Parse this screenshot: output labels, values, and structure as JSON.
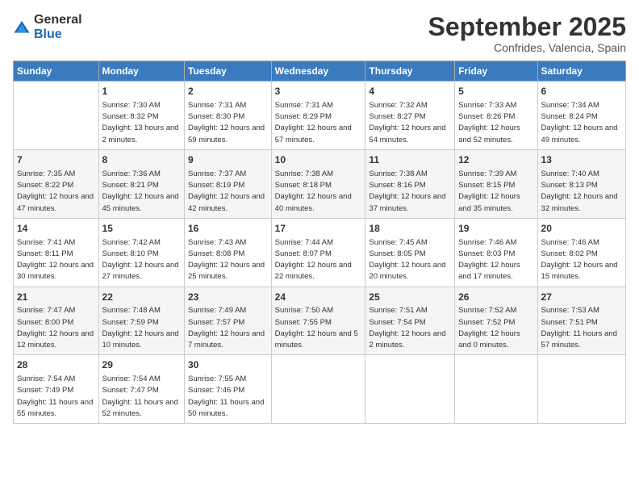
{
  "header": {
    "logo_general": "General",
    "logo_blue": "Blue",
    "title": "September 2025",
    "subtitle": "Confrides, Valencia, Spain"
  },
  "days_of_week": [
    "Sunday",
    "Monday",
    "Tuesday",
    "Wednesday",
    "Thursday",
    "Friday",
    "Saturday"
  ],
  "weeks": [
    [
      {
        "day": "",
        "sunrise": "",
        "sunset": "",
        "daylight": ""
      },
      {
        "day": "1",
        "sunrise": "Sunrise: 7:30 AM",
        "sunset": "Sunset: 8:32 PM",
        "daylight": "Daylight: 13 hours and 2 minutes."
      },
      {
        "day": "2",
        "sunrise": "Sunrise: 7:31 AM",
        "sunset": "Sunset: 8:30 PM",
        "daylight": "Daylight: 12 hours and 59 minutes."
      },
      {
        "day": "3",
        "sunrise": "Sunrise: 7:31 AM",
        "sunset": "Sunset: 8:29 PM",
        "daylight": "Daylight: 12 hours and 57 minutes."
      },
      {
        "day": "4",
        "sunrise": "Sunrise: 7:32 AM",
        "sunset": "Sunset: 8:27 PM",
        "daylight": "Daylight: 12 hours and 54 minutes."
      },
      {
        "day": "5",
        "sunrise": "Sunrise: 7:33 AM",
        "sunset": "Sunset: 8:26 PM",
        "daylight": "Daylight: 12 hours and 52 minutes."
      },
      {
        "day": "6",
        "sunrise": "Sunrise: 7:34 AM",
        "sunset": "Sunset: 8:24 PM",
        "daylight": "Daylight: 12 hours and 49 minutes."
      }
    ],
    [
      {
        "day": "7",
        "sunrise": "Sunrise: 7:35 AM",
        "sunset": "Sunset: 8:22 PM",
        "daylight": "Daylight: 12 hours and 47 minutes."
      },
      {
        "day": "8",
        "sunrise": "Sunrise: 7:36 AM",
        "sunset": "Sunset: 8:21 PM",
        "daylight": "Daylight: 12 hours and 45 minutes."
      },
      {
        "day": "9",
        "sunrise": "Sunrise: 7:37 AM",
        "sunset": "Sunset: 8:19 PM",
        "daylight": "Daylight: 12 hours and 42 minutes."
      },
      {
        "day": "10",
        "sunrise": "Sunrise: 7:38 AM",
        "sunset": "Sunset: 8:18 PM",
        "daylight": "Daylight: 12 hours and 40 minutes."
      },
      {
        "day": "11",
        "sunrise": "Sunrise: 7:38 AM",
        "sunset": "Sunset: 8:16 PM",
        "daylight": "Daylight: 12 hours and 37 minutes."
      },
      {
        "day": "12",
        "sunrise": "Sunrise: 7:39 AM",
        "sunset": "Sunset: 8:15 PM",
        "daylight": "Daylight: 12 hours and 35 minutes."
      },
      {
        "day": "13",
        "sunrise": "Sunrise: 7:40 AM",
        "sunset": "Sunset: 8:13 PM",
        "daylight": "Daylight: 12 hours and 32 minutes."
      }
    ],
    [
      {
        "day": "14",
        "sunrise": "Sunrise: 7:41 AM",
        "sunset": "Sunset: 8:11 PM",
        "daylight": "Daylight: 12 hours and 30 minutes."
      },
      {
        "day": "15",
        "sunrise": "Sunrise: 7:42 AM",
        "sunset": "Sunset: 8:10 PM",
        "daylight": "Daylight: 12 hours and 27 minutes."
      },
      {
        "day": "16",
        "sunrise": "Sunrise: 7:43 AM",
        "sunset": "Sunset: 8:08 PM",
        "daylight": "Daylight: 12 hours and 25 minutes."
      },
      {
        "day": "17",
        "sunrise": "Sunrise: 7:44 AM",
        "sunset": "Sunset: 8:07 PM",
        "daylight": "Daylight: 12 hours and 22 minutes."
      },
      {
        "day": "18",
        "sunrise": "Sunrise: 7:45 AM",
        "sunset": "Sunset: 8:05 PM",
        "daylight": "Daylight: 12 hours and 20 minutes."
      },
      {
        "day": "19",
        "sunrise": "Sunrise: 7:46 AM",
        "sunset": "Sunset: 8:03 PM",
        "daylight": "Daylight: 12 hours and 17 minutes."
      },
      {
        "day": "20",
        "sunrise": "Sunrise: 7:46 AM",
        "sunset": "Sunset: 8:02 PM",
        "daylight": "Daylight: 12 hours and 15 minutes."
      }
    ],
    [
      {
        "day": "21",
        "sunrise": "Sunrise: 7:47 AM",
        "sunset": "Sunset: 8:00 PM",
        "daylight": "Daylight: 12 hours and 12 minutes."
      },
      {
        "day": "22",
        "sunrise": "Sunrise: 7:48 AM",
        "sunset": "Sunset: 7:59 PM",
        "daylight": "Daylight: 12 hours and 10 minutes."
      },
      {
        "day": "23",
        "sunrise": "Sunrise: 7:49 AM",
        "sunset": "Sunset: 7:57 PM",
        "daylight": "Daylight: 12 hours and 7 minutes."
      },
      {
        "day": "24",
        "sunrise": "Sunrise: 7:50 AM",
        "sunset": "Sunset: 7:55 PM",
        "daylight": "Daylight: 12 hours and 5 minutes."
      },
      {
        "day": "25",
        "sunrise": "Sunrise: 7:51 AM",
        "sunset": "Sunset: 7:54 PM",
        "daylight": "Daylight: 12 hours and 2 minutes."
      },
      {
        "day": "26",
        "sunrise": "Sunrise: 7:52 AM",
        "sunset": "Sunset: 7:52 PM",
        "daylight": "Daylight: 12 hours and 0 minutes."
      },
      {
        "day": "27",
        "sunrise": "Sunrise: 7:53 AM",
        "sunset": "Sunset: 7:51 PM",
        "daylight": "Daylight: 11 hours and 57 minutes."
      }
    ],
    [
      {
        "day": "28",
        "sunrise": "Sunrise: 7:54 AM",
        "sunset": "Sunset: 7:49 PM",
        "daylight": "Daylight: 11 hours and 55 minutes."
      },
      {
        "day": "29",
        "sunrise": "Sunrise: 7:54 AM",
        "sunset": "Sunset: 7:47 PM",
        "daylight": "Daylight: 11 hours and 52 minutes."
      },
      {
        "day": "30",
        "sunrise": "Sunrise: 7:55 AM",
        "sunset": "Sunset: 7:46 PM",
        "daylight": "Daylight: 11 hours and 50 minutes."
      },
      {
        "day": "",
        "sunrise": "",
        "sunset": "",
        "daylight": ""
      },
      {
        "day": "",
        "sunrise": "",
        "sunset": "",
        "daylight": ""
      },
      {
        "day": "",
        "sunrise": "",
        "sunset": "",
        "daylight": ""
      },
      {
        "day": "",
        "sunrise": "",
        "sunset": "",
        "daylight": ""
      }
    ]
  ]
}
